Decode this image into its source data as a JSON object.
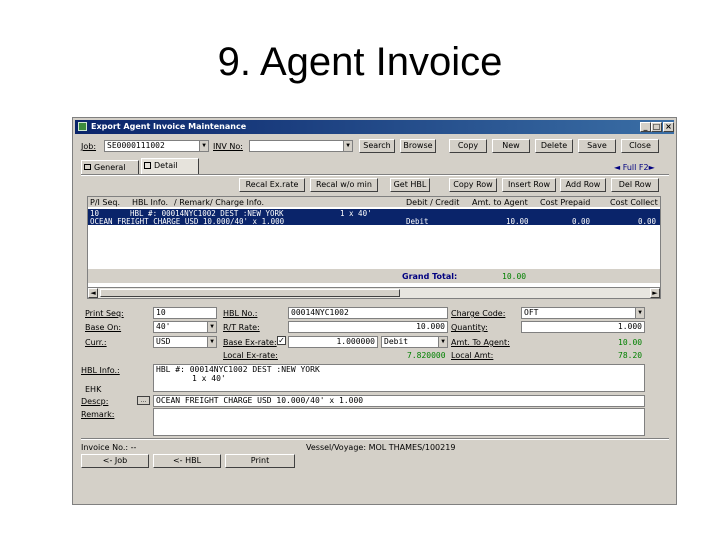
{
  "slide_title": "9. Agent Invoice",
  "window": {
    "title": "Export Agent Invoice Maintenance",
    "controls": [
      "_",
      "□",
      "×"
    ]
  },
  "toolbar": {
    "job_label": "Job:",
    "job_value": "SE0000111002",
    "inv_label": "INV No:",
    "inv_value": "",
    "buttons": [
      "Search",
      "Browse",
      "Copy",
      "New",
      "Delete",
      "Save",
      "Close"
    ]
  },
  "tabs": [
    "General",
    "Detail"
  ],
  "full_link": "◄ Full F2►",
  "action_buttons": [
    "Recal Ex.rate",
    "Recal w/o min",
    "Get HBL",
    "Copy Row",
    "Insert Row",
    "Add Row",
    "Del Row"
  ],
  "grid": {
    "headers": [
      "P/I Seq.",
      "HBL Info.",
      "/ Remark",
      "/ Charge Info.",
      "Debit / Credit",
      "Amt. to Agent",
      "Cost Prepaid",
      "Cost Collect"
    ],
    "row1": {
      "seq": "10",
      "hbl": "HBL #: 00014NYC1002 DEST :NEW YORK",
      "qty": "1 x 40'"
    },
    "row2": {
      "charge": "OCEAN FREIGHT CHARGE  USD  10.000/40' x 1.000",
      "dc": "Debit",
      "amt": "10.00",
      "prepaid": "0.00",
      "collect": "0.00"
    },
    "total_label": "Grand Total:",
    "total_value": "10.00"
  },
  "detail": {
    "print_seq_label": "Print Seq:",
    "print_seq_value": "10",
    "base_on_label": "Base On:",
    "base_on_value": "40'",
    "curr_label": "Curr.:",
    "curr_value": "USD",
    "hbl_no_label": "HBL No.:",
    "hbl_no_value": "00014NYC1002",
    "rt_rate_label": "R/T Rate:",
    "rt_rate_value": "10.000",
    "base_exrate_label": "Base Ex-rate:",
    "base_exrate_value": "1.000000",
    "dc_value": "Debit",
    "local_exrate_label": "Local Ex-rate:",
    "local_exrate_value": "7.820000",
    "charge_code_label": "Charge Code:",
    "charge_code_value": "OFT",
    "quantity_label": "Quantity:",
    "quantity_value": "1.000",
    "amt_to_agent_label": "Amt. To Agent:",
    "amt_to_agent_value": "10.00",
    "local_amt_label": "Local Amt:",
    "local_amt_value": "78.20",
    "hbl_info_label": "HBL Info.:",
    "hbl_info_line1": "HBL #: 00014NYC1002 DEST :NEW YORK",
    "hbl_info_line2": "1 x 40'",
    "ehk_label": "EHK",
    "descp_label": "Descp:",
    "descp_value": "OCEAN FREIGHT CHARGE  USD  10.000/40' x 1.000",
    "remark_label": "Remark:",
    "remark_value": ""
  },
  "footer": {
    "invoice_no": "Invoice No.: --",
    "vessel": "Vessel/Voyage: MOL THAMES/100219",
    "buttons": [
      "<- Job",
      "<- HBL",
      "Print"
    ]
  },
  "colors": {
    "title_bar": "#0a246a",
    "selected_row": "#0a246a",
    "window_face": "#d4d0c8",
    "value_green": "#008000"
  }
}
